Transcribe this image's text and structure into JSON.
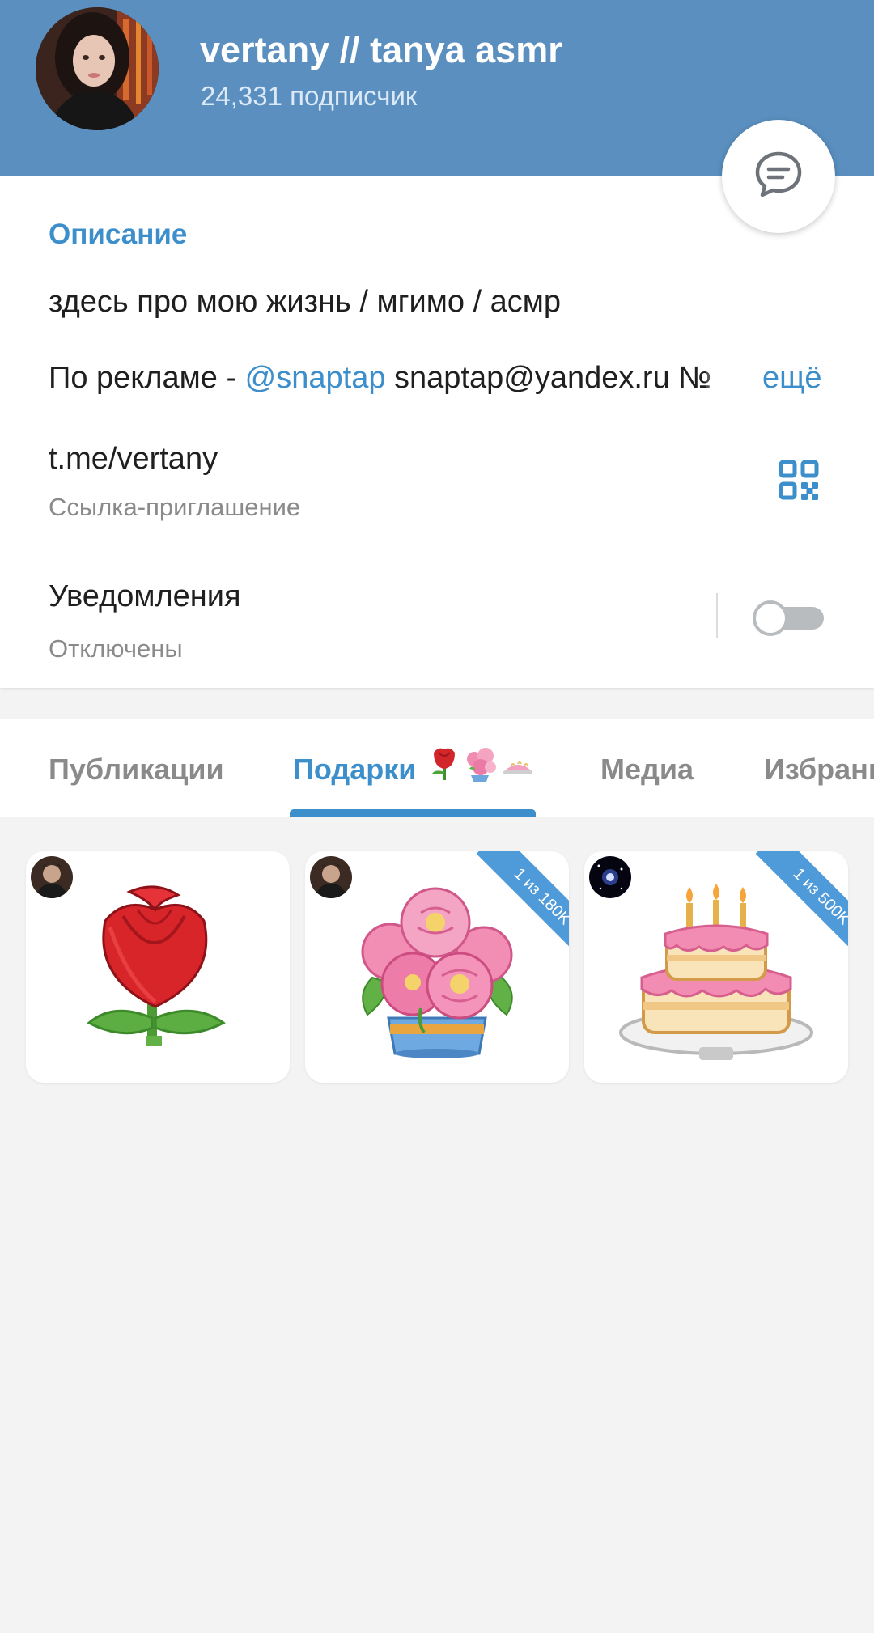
{
  "header": {
    "title": "vertany // tanya asmr",
    "subscribers": "24,331 подписчик"
  },
  "info": {
    "section_label": "Описание",
    "description": "здесь про мою жизнь / мгимо / асмр",
    "ad_prefix": "По рекламе - ",
    "ad_mention": "@snaptap",
    "ad_email": " snaptap@yandex.ru",
    "ad_overflow": " №",
    "more_label": "ещё",
    "link": "t.me/vertany",
    "link_sub": "Ссылка-приглашение",
    "notifications_title": "Уведомления",
    "notifications_sub": "Отключены",
    "notifications_enabled": false
  },
  "tabs": [
    {
      "label": "Публикации",
      "active": false
    },
    {
      "label": "Подарки",
      "active": true
    },
    {
      "label": "Медиа",
      "active": false
    },
    {
      "label": "Избранное",
      "active": false
    }
  ],
  "gifts": [
    {
      "name": "rose",
      "badge": ""
    },
    {
      "name": "bouquet",
      "badge": "1 из 180K"
    },
    {
      "name": "cake",
      "badge": "1 из 500K"
    }
  ],
  "colors": {
    "header": "#5a8fbf",
    "accent": "#3d8fcb",
    "ribbon": "#4f9ad8"
  },
  "icons": {
    "fab": "chat-bubble-icon",
    "qr": "qr-code-icon"
  }
}
